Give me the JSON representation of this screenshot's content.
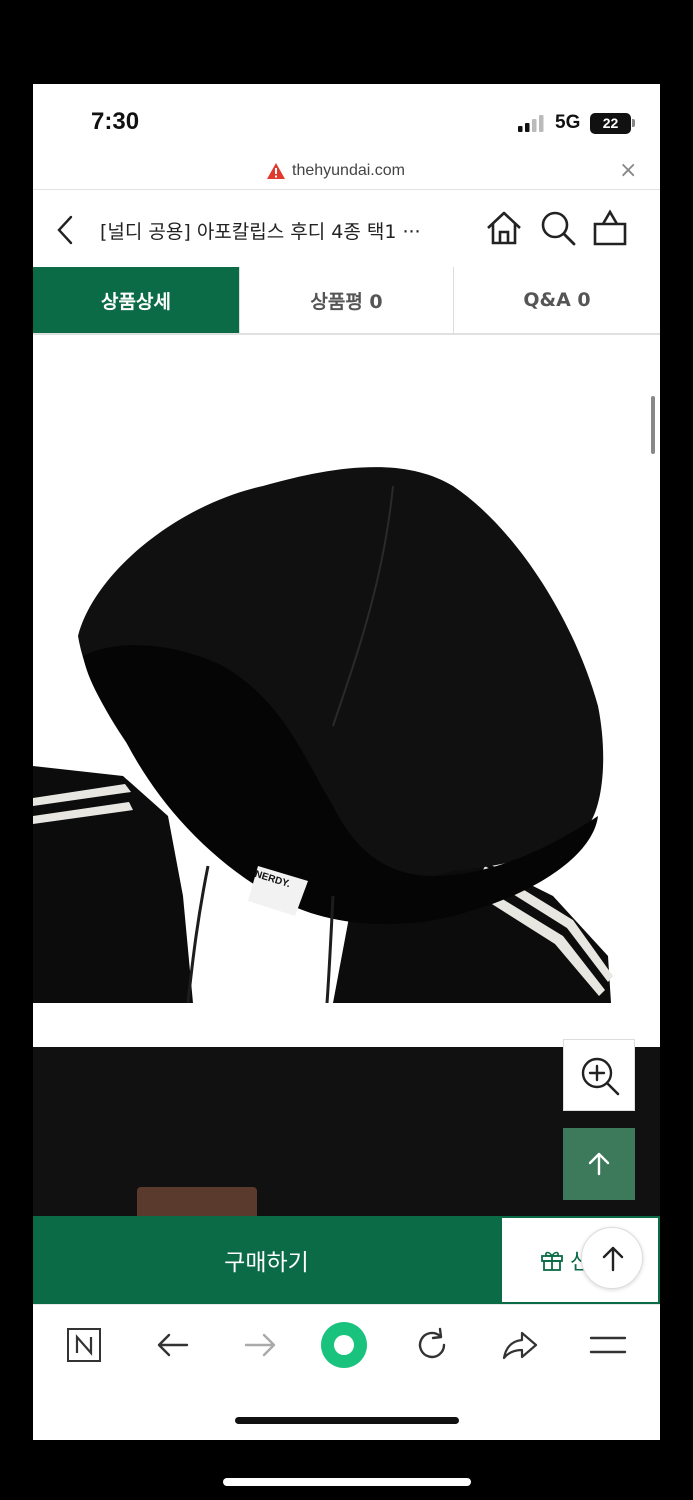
{
  "status_bar": {
    "time": "7:30",
    "network": "5G",
    "battery": "22"
  },
  "browser": {
    "url": "thehyundai.com",
    "close_glyph": "×"
  },
  "header": {
    "title": "[널디 공용] 아포칼립스 후디 4종 택1 ···"
  },
  "tabs": [
    {
      "label": "상품상세",
      "active": true
    },
    {
      "label": "상품평 0",
      "active": false
    },
    {
      "label": "Q&A 0",
      "active": false
    }
  ],
  "product": {
    "label_text": "NERDY."
  },
  "buybar": {
    "buy_label": "구매하기",
    "gift_label": "선"
  },
  "colors": {
    "brand_green": "#0b6b46",
    "top_button_green": "#3d7a5b",
    "warning_red": "#e03a2f"
  }
}
